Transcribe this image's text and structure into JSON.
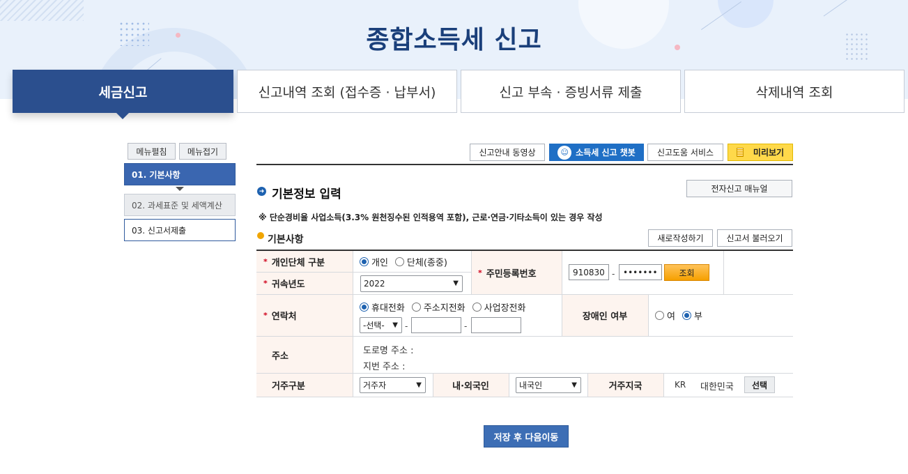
{
  "page": {
    "title": "종합소득세 신고"
  },
  "tabs": [
    {
      "label": "세금신고"
    },
    {
      "label": "신고내역 조회 (접수증 · 납부서)"
    },
    {
      "label": "신고 부속 · 증빙서류 제출"
    },
    {
      "label": "삭제내역 조회"
    }
  ],
  "sidebar": {
    "expand_label": "메뉴펼침",
    "collapse_label": "메뉴접기",
    "steps": [
      {
        "label": "01. 기본사항"
      },
      {
        "label": "02. 과세표준 및 세액계산"
      },
      {
        "label": "03. 신고서제출"
      }
    ]
  },
  "toolbar": {
    "guide_video": "신고안내 동영상",
    "chatbot": "소득세 신고 챗봇",
    "help_service": "신고도움 서비스",
    "preview": "미리보기"
  },
  "section": {
    "title": "기본정보 입력",
    "manual_button": "전자신고 매뉴얼",
    "notice": "※ 단순경비율 사업소득(3.3% 원천징수된 인적용역 포함), 근로·연금·기타소득이 있는 경우 작성",
    "subtitle": "기본사항",
    "new_button": "새로작성하기",
    "load_button": "신고서 불러오기"
  },
  "form": {
    "type_label": "개인단체 구분",
    "type_options": [
      "개인",
      "단체(종중)"
    ],
    "type_selected": "개인",
    "year_label": "귀속년도",
    "year_value": "2022",
    "rrn_label": "주민등록번호",
    "rrn_front": "910830",
    "rrn_back": "•••••••",
    "rrn_lookup": "조회",
    "contact_label": "연락처",
    "contact_options": [
      "휴대전화",
      "주소지전화",
      "사업장전화"
    ],
    "contact_selected": "휴대전화",
    "phone_prefix": "-선택-",
    "dash": "-",
    "disabled_label": "장애인 여부",
    "disabled_options": [
      "여",
      "부"
    ],
    "disabled_selected": "부",
    "address_label": "주소",
    "road_address": "도로명 주소 :",
    "lot_address": "지번 주소 :",
    "residence_label": "거주구분",
    "residence_value": "거주자",
    "nationality_label": "내·외국인",
    "nationality_value": "내국인",
    "country_label": "거주지국",
    "country_code": "KR",
    "country_name": "대한민국",
    "country_select": "선택"
  },
  "footer": {
    "save_next": "저장 후 다음이동"
  },
  "colors": {
    "brand": "#2b4f8e",
    "accent": "#1f6fc5",
    "highlight": "#ffd94a",
    "lookup": "#f6a000"
  }
}
